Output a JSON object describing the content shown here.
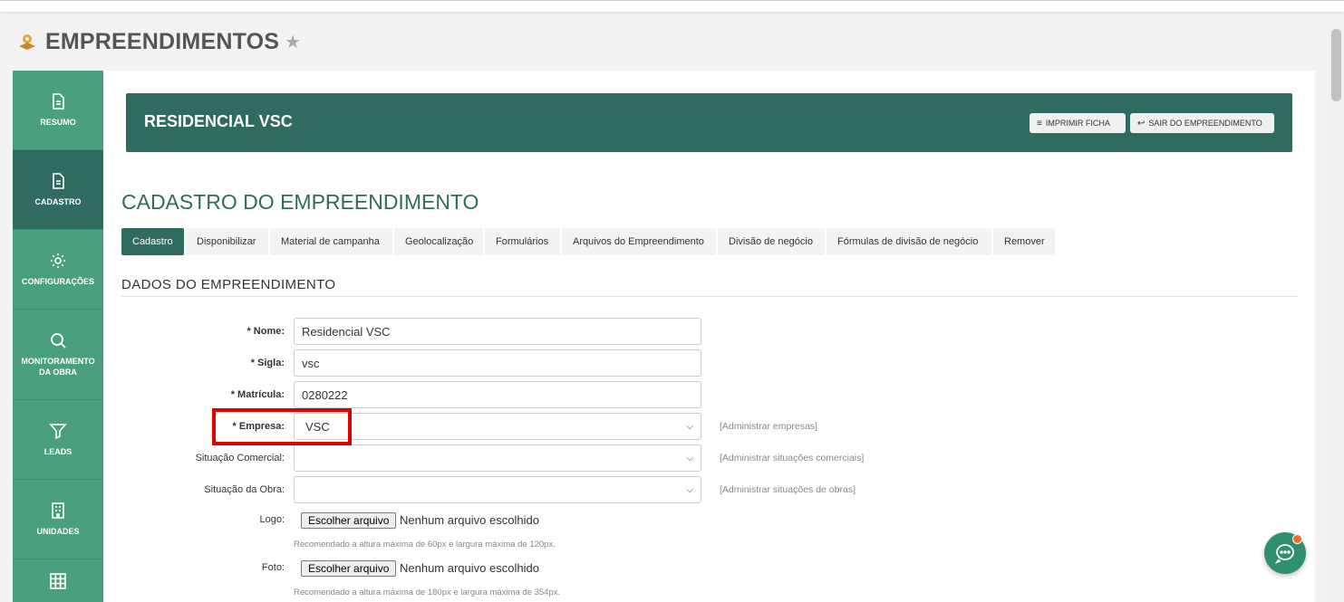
{
  "header": {
    "title": "EMPREENDIMENTOS"
  },
  "sidebar": {
    "items": [
      {
        "label": "RESUMO"
      },
      {
        "label": "CADASTRO"
      },
      {
        "label": "CONFIGURAÇÕES"
      },
      {
        "label": "MONITORAMENTO DA OBRA"
      },
      {
        "label": "LEADS"
      },
      {
        "label": "UNIDADES"
      }
    ]
  },
  "banner": {
    "title": "RESIDENCIAL VSC",
    "print_label": "IMPRIMIR FICHA",
    "exit_label": "SAIR DO EMPREENDIMENTO"
  },
  "section": {
    "title": "CADASTRO DO EMPREENDIMENTO",
    "subtitle": "DADOS DO EMPREENDIMENTO"
  },
  "tabs": [
    {
      "label": "Cadastro"
    },
    {
      "label": "Disponibilizar"
    },
    {
      "label": "Material de campanha"
    },
    {
      "label": "Geolocalização"
    },
    {
      "label": "Formulários"
    },
    {
      "label": "Arquivos do Empreendimento"
    },
    {
      "label": "Divisão de negócio"
    },
    {
      "label": "Fórmulas de divisão de negócio"
    },
    {
      "label": "Remover"
    }
  ],
  "form": {
    "nome": {
      "label": "* Nome:",
      "value": "Residencial VSC"
    },
    "sigla": {
      "label": "* Sigla:",
      "value": "vsc"
    },
    "matricula": {
      "label": "* Matrícula:",
      "value": "0280222"
    },
    "empresa": {
      "label": "* Empresa:",
      "value": "VSC",
      "admin": "[Administrar empresas]"
    },
    "situacao_comercial": {
      "label": "Situação Comercial:",
      "value": "",
      "admin": "[Administrar situações comerciais]"
    },
    "situacao_obra": {
      "label": "Situação da Obra:",
      "value": "",
      "admin": "[Administrar situações de obras]"
    },
    "logo": {
      "label": "Logo:",
      "button": "Escolher arquivo",
      "status": "Nenhum arquivo escolhido",
      "hint": "Recomendado a altura máxima de 60px e largura máxima de 120px."
    },
    "foto": {
      "label": "Foto:",
      "button": "Escolher arquivo",
      "status": "Nenhum arquivo escolhido",
      "hint": "Recomendado a altura máxima de 180px e largura máxima de 354px."
    }
  },
  "colors": {
    "primary": "#2f6b5f",
    "sidebar": "#4a9f7e",
    "highlight": "#e00000",
    "chat": "#2f8f6f"
  }
}
